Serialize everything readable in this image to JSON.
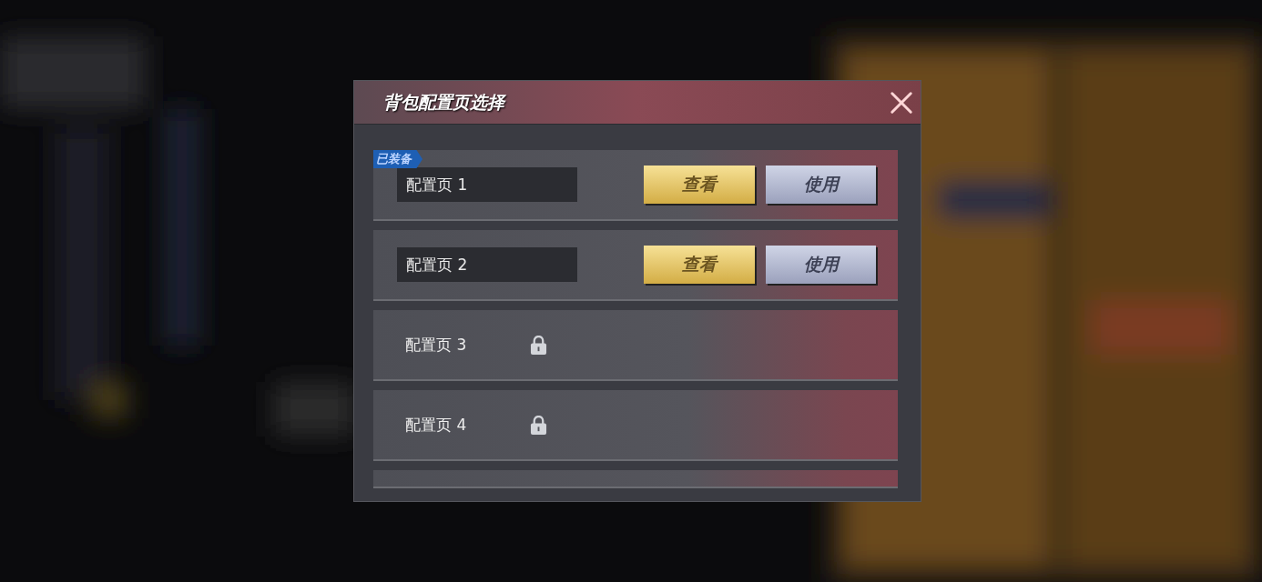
{
  "dialog": {
    "title": "背包配置页选择",
    "rows": [
      {
        "kind": "unlocked",
        "badge": "已装备",
        "name": "配置页 1",
        "buttons": [
          {
            "label": "查看",
            "kind": "gold"
          },
          {
            "label": "使用",
            "kind": "silver"
          }
        ]
      },
      {
        "kind": "unlocked",
        "name": "配置页 2",
        "buttons": [
          {
            "label": "查看",
            "kind": "gold"
          },
          {
            "label": "使用",
            "kind": "silver"
          }
        ]
      },
      {
        "kind": "locked",
        "name": "配置页 3"
      },
      {
        "kind": "locked",
        "name": "配置页 4"
      },
      {
        "kind": "partial"
      }
    ]
  }
}
